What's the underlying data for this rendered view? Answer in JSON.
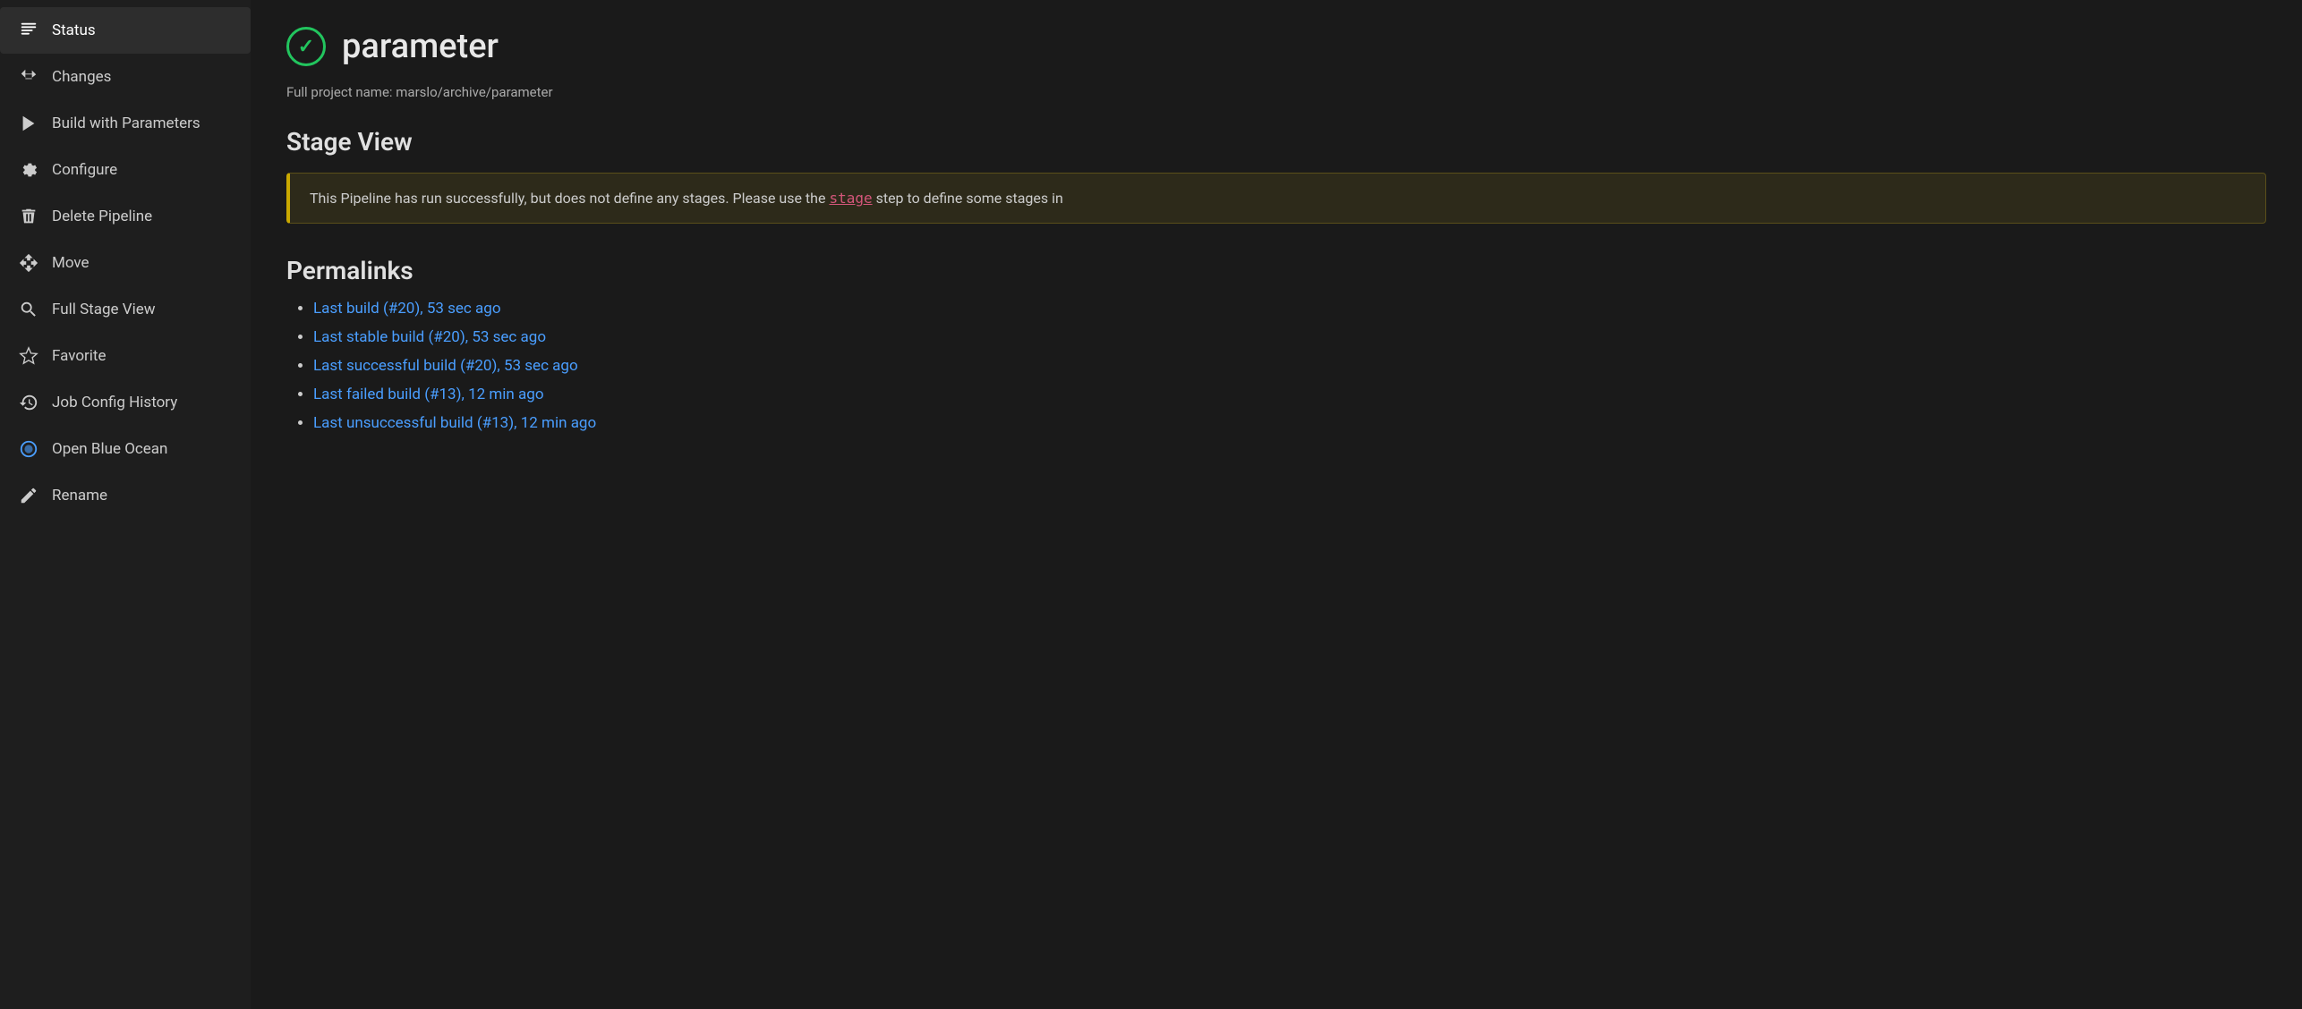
{
  "sidebar": {
    "items": [
      {
        "id": "status",
        "label": "Status",
        "icon": "status",
        "active": true
      },
      {
        "id": "changes",
        "label": "Changes",
        "icon": "changes"
      },
      {
        "id": "build-with-parameters",
        "label": "Build with Parameters",
        "icon": "build"
      },
      {
        "id": "configure",
        "label": "Configure",
        "icon": "configure"
      },
      {
        "id": "delete-pipeline",
        "label": "Delete Pipeline",
        "icon": "delete"
      },
      {
        "id": "move",
        "label": "Move",
        "icon": "move"
      },
      {
        "id": "full-stage-view",
        "label": "Full Stage View",
        "icon": "stage-view"
      },
      {
        "id": "favorite",
        "label": "Favorite",
        "icon": "favorite"
      },
      {
        "id": "job-config-history",
        "label": "Job Config History",
        "icon": "history"
      },
      {
        "id": "open-blue-ocean",
        "label": "Open Blue Ocean",
        "icon": "blue-ocean"
      },
      {
        "id": "rename",
        "label": "Rename",
        "icon": "rename"
      }
    ]
  },
  "main": {
    "page_title": "parameter",
    "full_project_name_label": "Full project name:",
    "full_project_name_value": "marslo/archive/parameter",
    "stage_view_title": "Stage View",
    "warning_message_before": "This Pipeline has run successfully, but does not define any stages. Please use the ",
    "warning_stage_link": "stage",
    "warning_message_after": " step to define some stages in",
    "permalinks_title": "Permalinks",
    "permalinks": [
      {
        "id": "last-build",
        "text": "Last build (#20), 53 sec ago",
        "href": "#"
      },
      {
        "id": "last-stable-build",
        "text": "Last stable build (#20), 53 sec ago",
        "href": "#"
      },
      {
        "id": "last-successful-build",
        "text": "Last successful build (#20), 53 sec ago",
        "href": "#"
      },
      {
        "id": "last-failed-build",
        "text": "Last failed build (#13), 12 min ago",
        "href": "#"
      },
      {
        "id": "last-unsuccessful-build",
        "text": "Last unsuccessful build (#13), 12 min ago",
        "href": "#"
      }
    ]
  }
}
